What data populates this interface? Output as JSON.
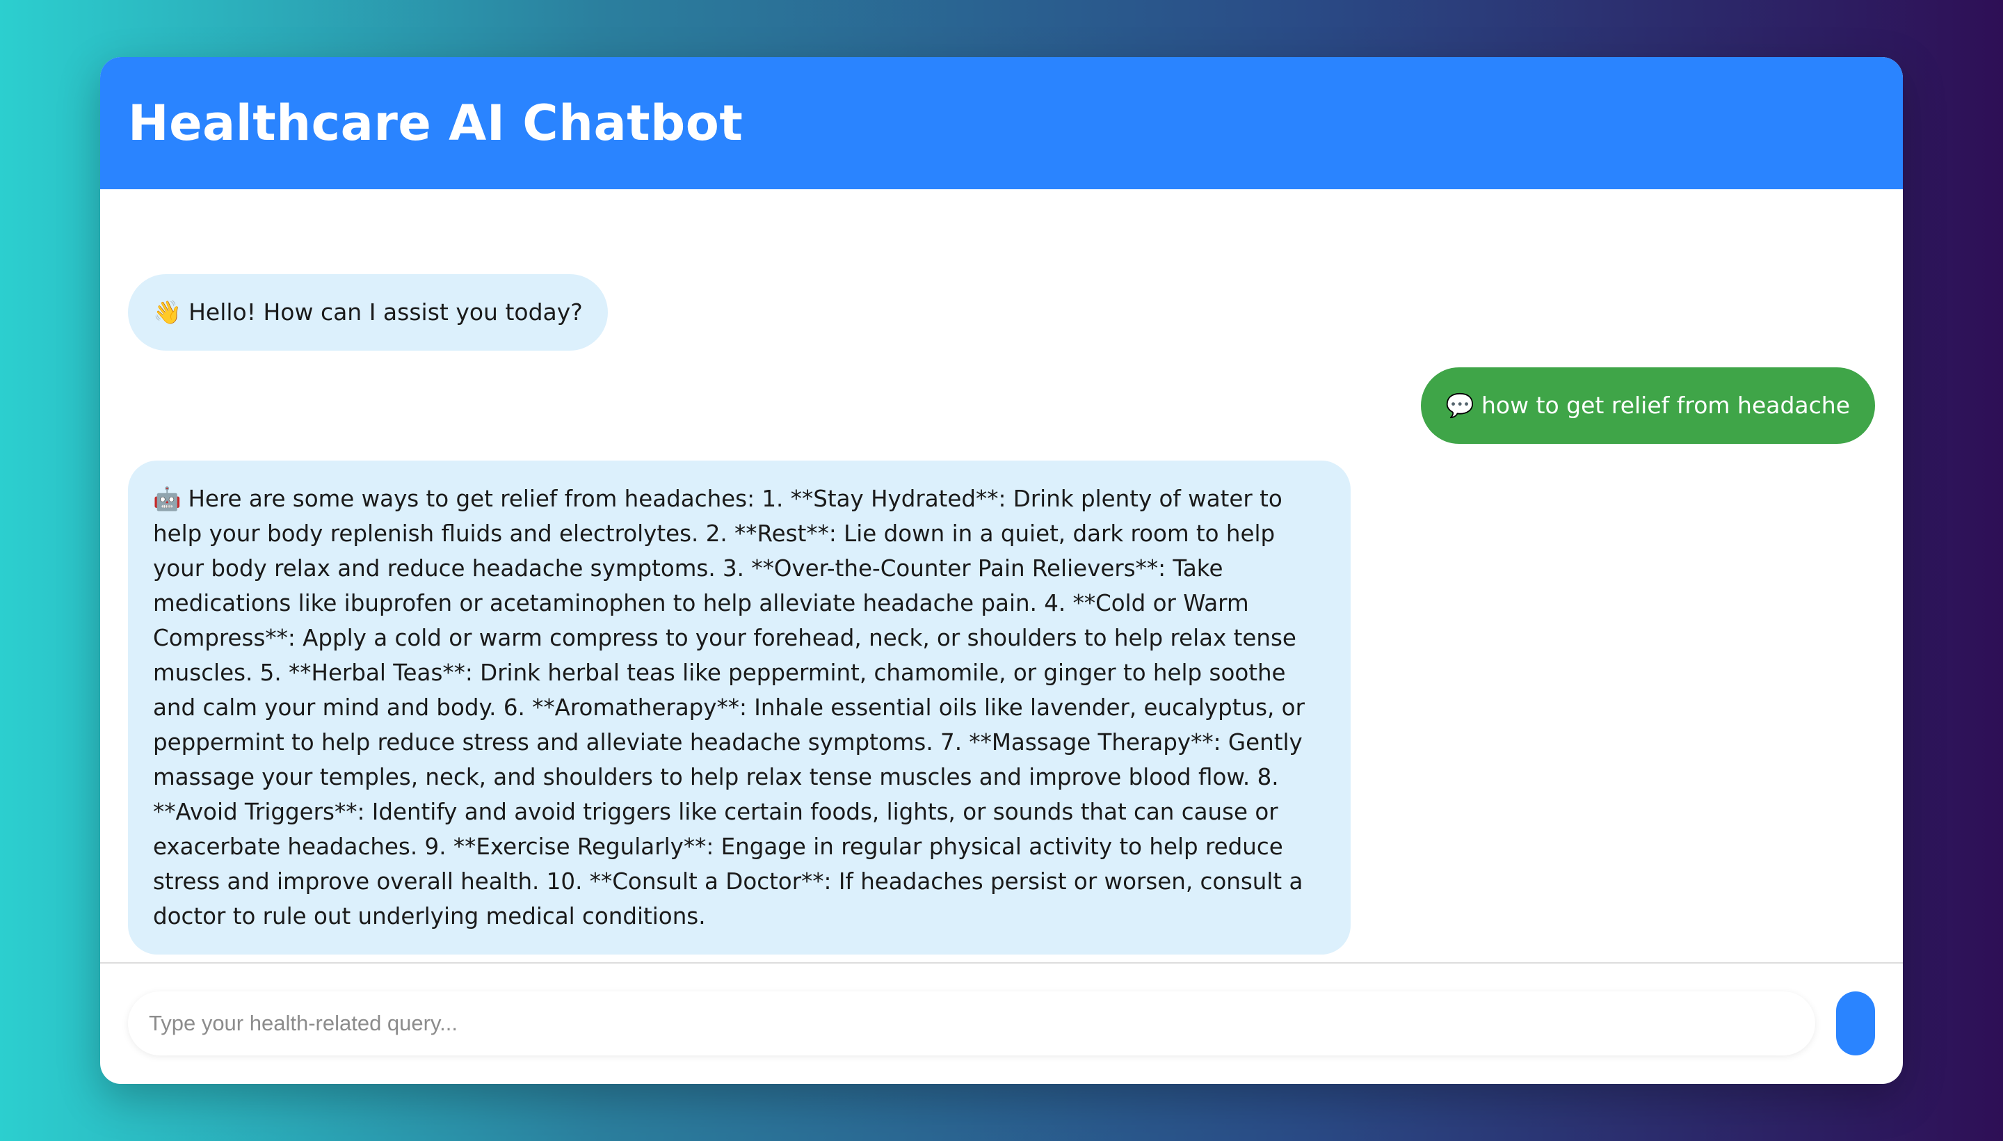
{
  "header": {
    "title": "Healthcare AI Chatbot"
  },
  "messages": [
    {
      "role": "bot",
      "icon": "waving-hand-icon",
      "emoji": "👋",
      "text": "Hello! How can I assist you today?"
    },
    {
      "role": "user",
      "icon": "speech-bubble-icon",
      "emoji": "💬",
      "text": "how to get relief from headache"
    },
    {
      "role": "bot",
      "icon": "robot-icon",
      "emoji": "🤖",
      "text": "Here are some ways to get relief from headaches: 1. **Stay Hydrated**: Drink plenty of water to help your body replenish fluids and electrolytes. 2. **Rest**: Lie down in a quiet, dark room to help your body relax and reduce headache symptoms. 3. **Over-the-Counter Pain Relievers**: Take medications like ibuprofen or acetaminophen to help alleviate headache pain. 4. **Cold or Warm Compress**: Apply a cold or warm compress to your forehead, neck, or shoulders to help relax tense muscles. 5. **Herbal Teas**: Drink herbal teas like peppermint, chamomile, or ginger to help soothe and calm your mind and body. 6. **Aromatherapy**: Inhale essential oils like lavender, eucalyptus, or peppermint to help reduce stress and alleviate headache symptoms. 7. **Massage Therapy**: Gently massage your temples, neck, and shoulders to help relax tense muscles and improve blood flow. 8. **Avoid Triggers**: Identify and avoid triggers like certain foods, lights, or sounds that can cause or exacerbate headaches. 9. **Exercise Regularly**: Engage in regular physical activity to help reduce stress and improve overall health. 10. **Consult a Doctor**: If headaches persist or worsen, consult a doctor to rule out underlying medical conditions."
    }
  ],
  "input": {
    "placeholder": "Type your health-related query...",
    "value": ""
  },
  "colors": {
    "header": "#2a84ff",
    "bot_bubble": "#dcf0fc",
    "user_bubble": "#3fa548",
    "send_button": "#2a84ff"
  }
}
